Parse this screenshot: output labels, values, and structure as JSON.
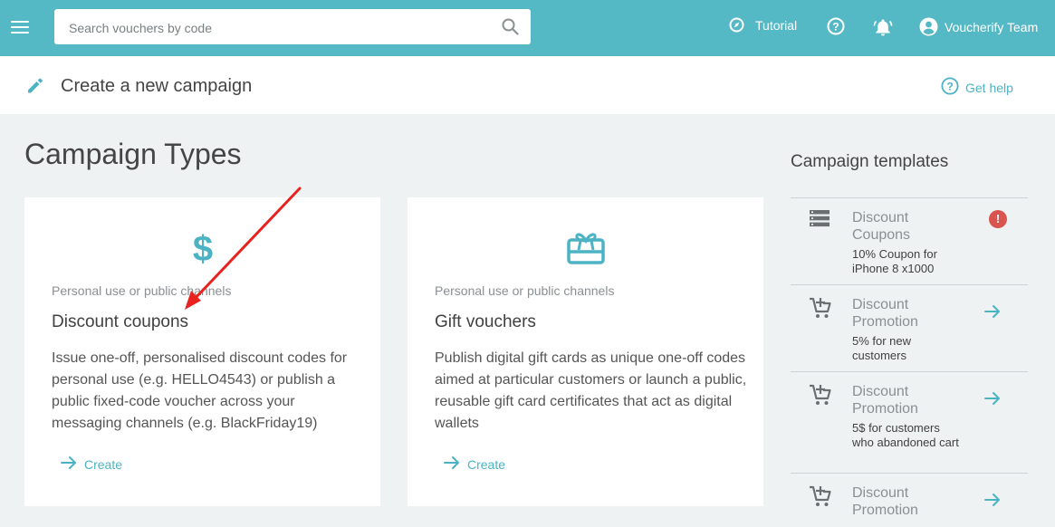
{
  "topbar": {
    "search_placeholder": "Search vouchers by code",
    "tutorial_label": "Tutorial",
    "user_label": "Voucherify Team"
  },
  "subheader": {
    "title": "Create a new campaign",
    "help_label": "Get help"
  },
  "main": {
    "heading": "Campaign Types",
    "cards": [
      {
        "icon": "dollar-icon",
        "eyebrow": "Personal use or public channels",
        "title": "Discount coupons",
        "description": "Issue one-off, personalised discount codes for personal use (e.g. HELLO4543) or publish a public fixed-code voucher across your messaging channels (e.g. BlackFriday19)",
        "action": "Create"
      },
      {
        "icon": "gift-card-icon",
        "eyebrow": "Personal use or public channels",
        "title": "Gift vouchers",
        "description": "Publish digital gift cards as unique one-off codes aimed at particular customers or launch a public, reusable gift card certificates that act as digital wallets",
        "action": "Create"
      }
    ]
  },
  "templates": {
    "title": "Campaign templates",
    "items": [
      {
        "icon": "list-icon",
        "name": "Discount Coupons",
        "description": "10% Coupon for iPhone 8 x1000",
        "badge": "!"
      },
      {
        "icon": "add-cart-icon",
        "name": "Discount Promotion",
        "description": "5% for new customers"
      },
      {
        "icon": "add-cart-icon",
        "name": "Discount Promotion",
        "description": "5$ for customers who abandoned cart"
      },
      {
        "icon": "add-cart-icon",
        "name": "Discount Promotion",
        "description": ""
      }
    ]
  },
  "colors": {
    "brand": "#55b8c5",
    "accent": "#4bb3c4",
    "alert": "#d9534f",
    "annotation_arrow": "#e8221f"
  }
}
